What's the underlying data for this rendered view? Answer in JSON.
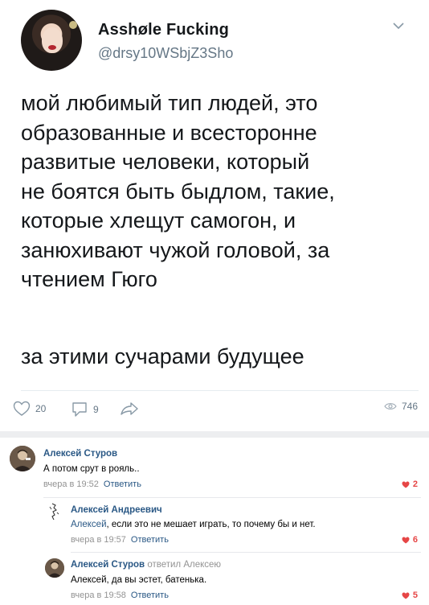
{
  "tweet": {
    "display_name": "Asshøle Fucking",
    "handle": "@drsy10WSbjZ3Sho",
    "text": "мой любимый тип людей, это\nобразованные и всесторонне\nразвитые человеки, который\nне боятся быть быдлом, такие,\nкоторые хлещут самогон, и\nзанюхивают чужой головой, за\nчтением Гюго",
    "text2": "за этими сучарами будущее",
    "likes": "20",
    "replies": "9",
    "views": "746"
  },
  "comments": [
    {
      "author": "Алексей Стуров",
      "text": "А потом срут в рояль..",
      "time": "вчера в 19:52",
      "reply_label": "Ответить",
      "likes": "2"
    },
    {
      "author": "Алексей Андреевич",
      "mention": "Алексей",
      "text": ", если это не мешает играть, то почему бы и нет.",
      "time": "вчера в 19:57",
      "reply_label": "Ответить",
      "likes": "6"
    },
    {
      "author": "Алексей Стуров",
      "replied_to": "ответил Алексею",
      "text": "Алексей, да вы эстет, батенька.",
      "time": "вчера в 19:58",
      "reply_label": "Ответить",
      "likes": "5"
    }
  ],
  "colors": {
    "vk_link": "#2a5885",
    "like_red": "#e64646",
    "meta_gray": "#939393",
    "twitter_gray": "#657786"
  }
}
